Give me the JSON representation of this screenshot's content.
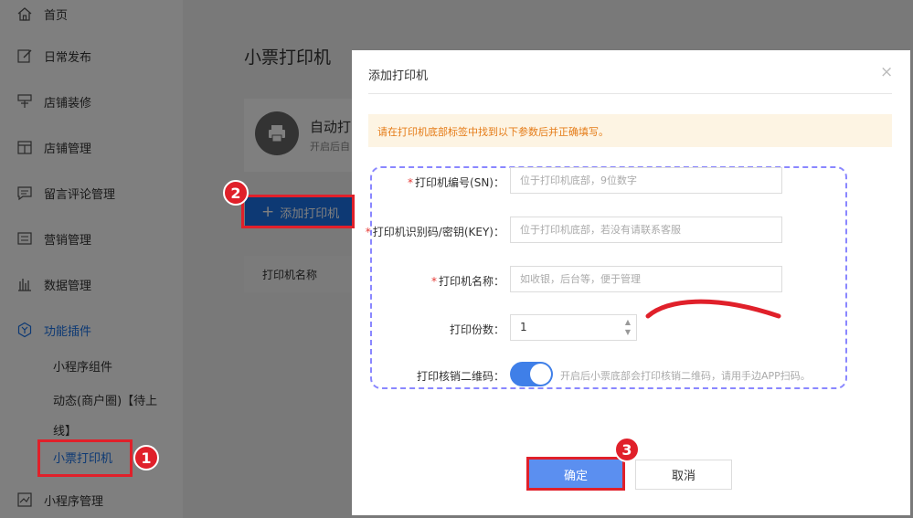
{
  "sidebar": {
    "items": [
      {
        "label": "首页",
        "icon": "home-icon"
      },
      {
        "label": "日常发布",
        "icon": "edit-icon"
      },
      {
        "label": "店铺装修",
        "icon": "brush-icon"
      },
      {
        "label": "店铺管理",
        "icon": "shop-icon"
      },
      {
        "label": "留言评论管理",
        "icon": "comment-icon"
      },
      {
        "label": "营销管理",
        "icon": "marketing-icon"
      },
      {
        "label": "数据管理",
        "icon": "chart-icon"
      },
      {
        "label": "功能插件",
        "icon": "plugin-icon"
      }
    ],
    "sub_items": {
      "miniprogram_component": "小程序组件",
      "dynamic_line1": "动态(商户圈)【待上",
      "dynamic_line2": "线】",
      "receipt_printer": "小票打印机"
    },
    "bottom_item": {
      "label": "小程序管理",
      "icon": "miniprogram-icon"
    }
  },
  "main": {
    "page_title": "小票打印机",
    "card_title": "自动打",
    "card_subtitle": "开启后自",
    "add_button": "添加打印机",
    "table_header_name": "打印机名称"
  },
  "dialog": {
    "title": "添加打印机",
    "close": "×",
    "notice": "请在打印机底部标签中找到以下参数后并正确填写。",
    "fields": {
      "sn": {
        "required": "*",
        "label": "打印机编号(SN)：",
        "placeholder": "位于打印机底部，9位数字"
      },
      "key": {
        "required": "*",
        "label": "打印机识别码/密钥(KEY)：",
        "placeholder": "位于打印机底部，若没有请联系客服"
      },
      "name": {
        "required": "*",
        "label": "打印机名称：",
        "placeholder": "如收银，后台等，便于管理"
      },
      "copies": {
        "label": "打印份数：",
        "value": "1"
      },
      "qrcode": {
        "label": "打印核销二维码：",
        "enabled": true,
        "hint": "开启后小票底部会打印核销二维码，请用手边APP扫码。"
      }
    },
    "ok_button": "确定",
    "cancel_button": "取消"
  },
  "annotations": {
    "badge1": "1",
    "badge2": "2",
    "badge3": "3"
  },
  "colors": {
    "accent": "#1a73e8",
    "highlight": "#e0202a",
    "notice_text": "#e57b17"
  }
}
